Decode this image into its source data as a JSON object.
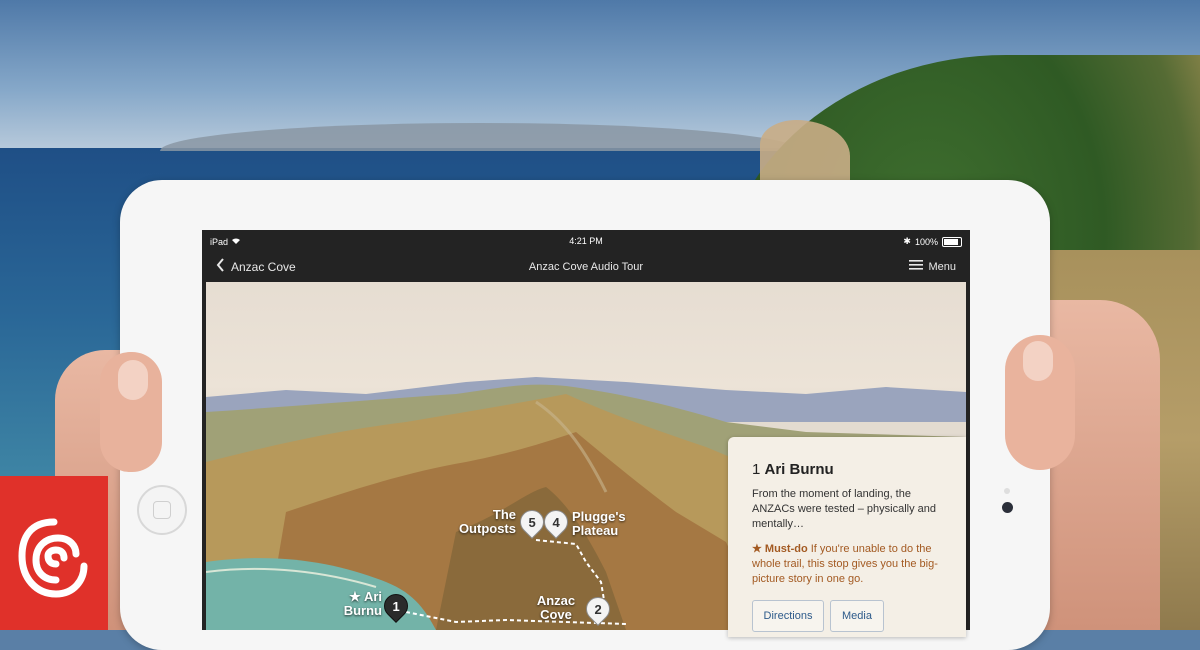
{
  "status_bar": {
    "device": "iPad",
    "time": "4:21 PM",
    "battery": "100%"
  },
  "nav_bar": {
    "back_label": "Anzac Cove",
    "title": "Anzac Cove Audio Tour",
    "menu_label": "Menu"
  },
  "map": {
    "labels": {
      "outposts": "The Outposts",
      "plugges": "Plugge's Plateau",
      "ari": "★ Ari Burnu",
      "anzac": "Anzac Cove"
    },
    "pins": [
      {
        "number": "1",
        "active": true
      },
      {
        "number": "2",
        "active": false
      },
      {
        "number": "4",
        "active": false
      },
      {
        "number": "5",
        "active": false
      }
    ]
  },
  "card": {
    "stop_number": "1",
    "stop_title": "Ari Burnu",
    "description": "From the moment of landing, the ANZACs were tested – physically and mentally…",
    "must_do_label": "★ Must-do",
    "must_do_text": "If you're unable to do the whole trail, this stop gives you the big-picture story in one go.",
    "directions_label": "Directions",
    "media_label": "Media"
  },
  "colors": {
    "brand_red": "#e0312a",
    "must_do": "#a35a22",
    "button_text": "#2d5a8a"
  },
  "icons": {
    "back": "chevron-left-icon",
    "menu": "hamburger-icon",
    "wifi": "wifi-icon",
    "bluetooth": "bluetooth-icon",
    "battery": "battery-icon",
    "logo": "rnz-logo"
  }
}
